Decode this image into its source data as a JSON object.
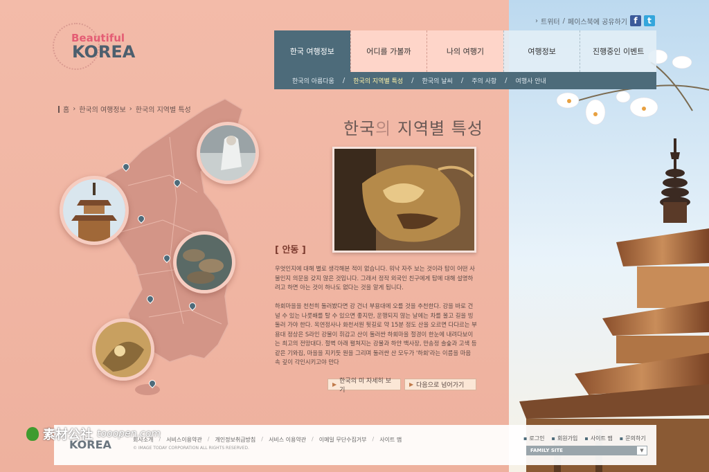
{
  "logo": {
    "top": "Beautiful",
    "main": "KOREA"
  },
  "social": {
    "twitter": "트위터",
    "facebook": "페이스북에 공유하기",
    "fb_icon": "f",
    "tw_icon": "t"
  },
  "nav": [
    {
      "label": "한국 여행정보"
    },
    {
      "label": "어디를 가볼까"
    },
    {
      "label": "나의 여행기"
    },
    {
      "label": "여행정보"
    },
    {
      "label": "진행중인 이벤트"
    }
  ],
  "subnav": [
    {
      "label": "한국의 아름다움"
    },
    {
      "label": "한국의 지역별 특성"
    },
    {
      "label": "한국의 날씨"
    },
    {
      "label": "주의 사항"
    },
    {
      "label": "여행사 안내"
    }
  ],
  "breadcrumb": {
    "home": "홈",
    "level1": "한국의 여행정보",
    "level2": "한국의 지역별 특성"
  },
  "page_title": {
    "part1": "한국",
    "part2": "의",
    "part3": " 지역별 특성"
  },
  "section": {
    "heading": "[ 안동 ]",
    "para1": "우엇인지에 대해 별로 생각해본 적이 없습니다. 워낙 자주 보는 것이라 탑이 어떤 사물인지 의문을 갖지 않은 것입니다. 그래서 정작 외국인 친구에게 탑에 대해 설명하려고 하면 아는 것이 하나도 없다는 것을 알게 됩니다.",
    "para2": "하회마을을 천천히 둘러봤다면 강 건너 부용대에 오를 것을 추천한다. 강을 바로 건널 수 있는 나룻배를 탈 수 있으면 좋지만, 운행되지 않는 날에는 차를 몰고 길을 빙 둘러 가야 한다. 옥연정사나 화천서원 뒷길로 약 15분 정도 산을 오르면 다다르는 부용대 정상은 S라인 강물이 휘감고 산이 둘러싼 하회마을 절경이 한눈에 내려다보이는 최고의 전망대다. 절벽 아래 펼쳐지는 강물과 하얀 백사장, 만송정 솔숲과 고색 등 같은 기와집, 마을을 지키듯 원을 그리며 둘러싼 산 모두가 '하회'라는 이름을 마음 속 깊이 각인시키고야 만다"
  },
  "buttons": {
    "more": "한국의 미 자세히 보기",
    "next": "다음으로 넘어가기"
  },
  "footer": {
    "logo": "KOREA",
    "links": [
      "회사소개",
      "서비스이용약관",
      "개인정보취급방침",
      "서비스 이용약관",
      "이메일 무단수집거부",
      "사이트 맵"
    ],
    "copyright": "© IMAGE TODAY CORPORATION ALL RIGHTS RESERVED.",
    "right_links": [
      "로그인",
      "회원가입",
      "사이트 맵",
      "문의하기"
    ],
    "family_site": "FAMILY SITE",
    "family_btn": "▼"
  },
  "watermark": {
    "text": "素材公社",
    "url": "tooopen.com"
  },
  "colors": {
    "nav_active": "#4d6b7a",
    "background": "#f1b6a4",
    "subnav_active": "#fff2a8"
  }
}
